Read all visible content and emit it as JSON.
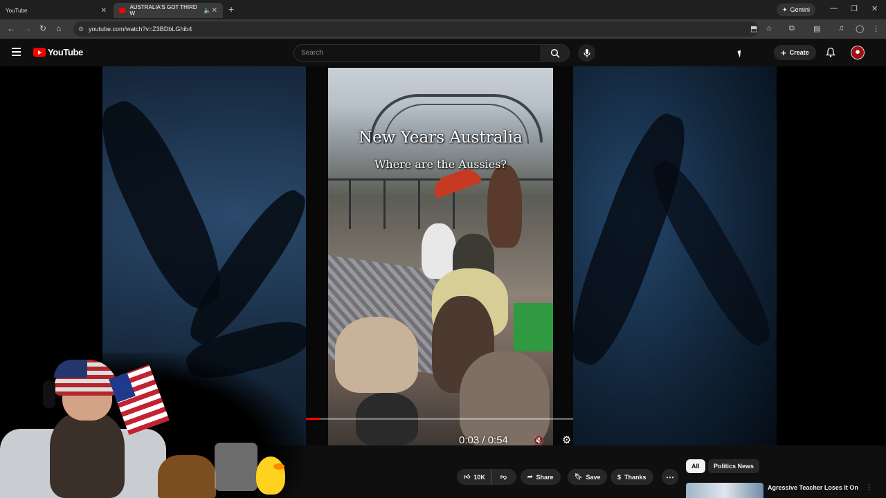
{
  "browser": {
    "tabs": [
      {
        "label": "YouTube"
      },
      {
        "label": "AUSTRALIA'S GOT THIRD W"
      }
    ],
    "new_tab_symbol": "+",
    "gemini_label": "Gemini",
    "url": "youtube.com/watch?v=Z3BDbLGhib4"
  },
  "youtube": {
    "logo_text": "YouTube",
    "search_placeholder": "Search",
    "create_label": "Create"
  },
  "video": {
    "overlay_title": "New Years Australia",
    "overlay_subtitle": "Where are the Aussies?",
    "time_current": "0:03",
    "time_total": "0:54",
    "time_display": "0:03 / 0:54",
    "progress_fraction": 0.055
  },
  "actions": {
    "like_count": "10K",
    "share_label": "Share",
    "save_label": "Save",
    "thanks_label": "Thanks"
  },
  "related": {
    "chips": [
      "All",
      "Politics News"
    ],
    "first_title": "Agressive Teacher Loses It On"
  },
  "icons": [
    "hamburger-icon",
    "search-icon",
    "mic-icon",
    "plus-icon",
    "bell-icon",
    "like-icon",
    "dislike-icon",
    "share-icon",
    "save-icon",
    "thanks-icon",
    "more-icon",
    "mute-icon",
    "settings-icon"
  ]
}
